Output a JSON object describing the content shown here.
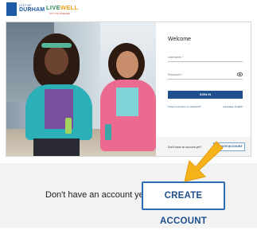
{
  "header": {
    "durham_logo_small": "CITY OF",
    "durham_logo_main": "DURHAM",
    "livewell_logo_main_a": "LIVE",
    "livewell_logo_main_b": "WELL",
    "livewell_logo_sub": "CITY OF DURHAM"
  },
  "login": {
    "title": "Welcome",
    "username_placeholder": "Username *",
    "password_placeholder": "Password *",
    "sign_in_label": "SIGN IN",
    "forgot_link": "Forgot username or password?",
    "language_link": "Language: English",
    "no_account_text": "Don't have an account yet?",
    "create_account_label": "CREATE ACCOUNT"
  },
  "zoom": {
    "no_account_text": "Don't have an account yet?",
    "create_account_label": "CREATE ACCOUNT"
  },
  "colors": {
    "brand_blue": "#1e4f8f",
    "arrow_yellow": "#f5b21a"
  },
  "icons": {
    "password_toggle": "eye-icon",
    "callout": "arrow-icon"
  }
}
